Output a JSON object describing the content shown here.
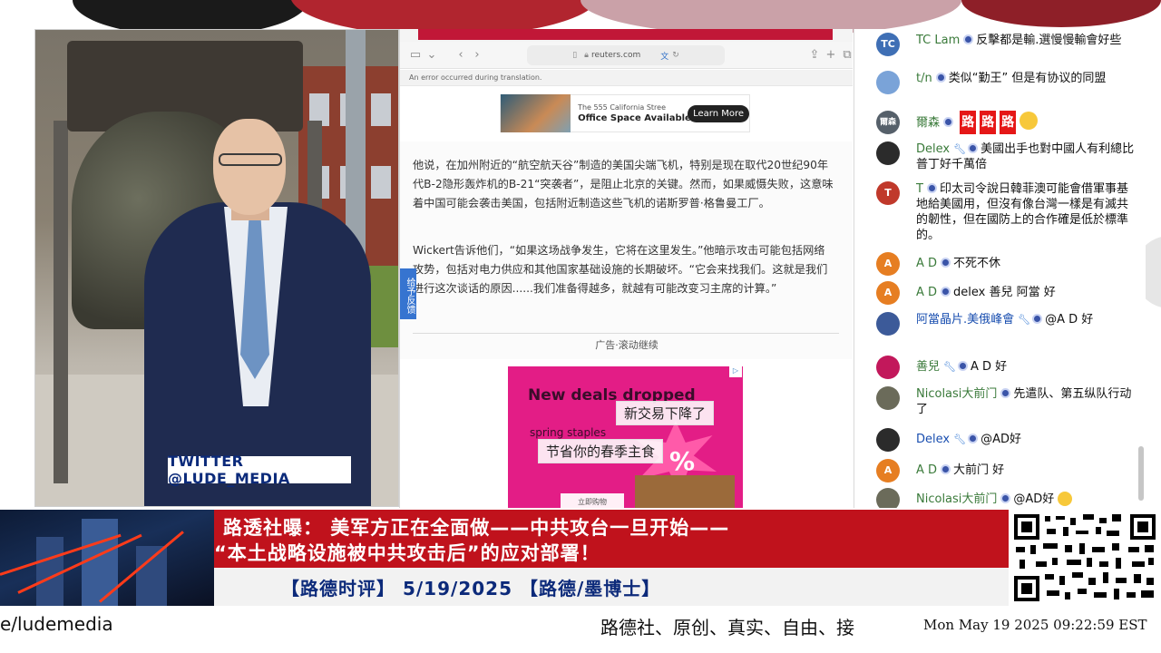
{
  "video": {
    "twitter_label": "TWITTER  @LUDE_MEDIA"
  },
  "browser": {
    "url": "reuters.com",
    "error_text": "An error occurred during translation.",
    "side_tab": "给予反馈",
    "ad_top": {
      "line1": "The 555 California Stree",
      "line2": "Office Space Available",
      "button": "Learn More"
    },
    "paragraphs": [
      "他说，在加州附近的“航空航天谷”制造的美国尖端飞机，特别是现在取代20世纪90年代B-2隐形轰炸机的B-21“突袭者”，是阻止北京的关键。然而，如果威慑失败，这意味着中国可能会袭击美国，包括附近制造这些飞机的诺斯罗普·格鲁曼工厂。",
      "Wickert告诉他们，“如果这场战争发生，它将在这里发生。”他暗示攻击可能包括网络攻势，包括对电力供应和其他国家基础设施的长期破坏。“它会来找我们。这就是我们进行这次谈话的原因......我们准备得越多，就越有可能改变习主席的计算。”"
    ],
    "ad_label": "广告·滚动继续",
    "ad_bottom": {
      "headline": "New deals dropped",
      "sub": "spring staples",
      "overlay1": "新交易下降了",
      "overlay2": "节省你的春季主食",
      "cta": "立即购物",
      "percent": "%"
    }
  },
  "chat": {
    "messages": [
      {
        "avatar": "TC",
        "avatar_color": "#3f6fb5",
        "name": "TC Lam",
        "text": "反擊都是輸.選慢慢輸會好些"
      },
      {
        "avatar": "",
        "avatar_color": "#7aa3d8",
        "name": "t/n",
        "text": "类似“勤王” 但是有协议的同盟"
      },
      {
        "avatar": "爾森",
        "avatar_color": "#56606a",
        "name": "爾森",
        "text": ""
      },
      {
        "avatar": "",
        "avatar_color": "#2b2b2b",
        "name": "Delex",
        "text": "美國出手也對中國人有利總比普丁好千萬倍"
      },
      {
        "avatar": "T",
        "avatar_color": "#c0392b",
        "name": "T",
        "text": "印太司令說日韓菲澳可能會借軍事基地給美國用，但沒有像台灣一樣是有滅共的韌性，但在國防上的合作確是低於標準的。"
      },
      {
        "avatar": "A",
        "avatar_color": "#e67e22",
        "name": "A D",
        "text": "不死不休"
      },
      {
        "avatar": "A",
        "avatar_color": "#e67e22",
        "name": "A D",
        "text": "delex 善兒 阿當 好"
      },
      {
        "avatar": "",
        "avatar_color": "#3c5a99",
        "name": "阿當晶片.美俄峰會",
        "text": "@A D 好"
      },
      {
        "avatar": "",
        "avatar_color": "#c2185b",
        "name": "善兒",
        "text": "A D 好"
      },
      {
        "avatar": "",
        "avatar_color": "#6b6b5a",
        "name": "Nicolasi大前门",
        "text": "先遣队、第五纵队行动了"
      },
      {
        "avatar": "",
        "avatar_color": "#2b2b2b",
        "name": "Delex",
        "text": "@AD好"
      },
      {
        "avatar": "A",
        "avatar_color": "#e67e22",
        "name": "A D",
        "text": "大前门 好"
      },
      {
        "avatar": "",
        "avatar_color": "#6b6b5a",
        "name": "Nicolasi大前门",
        "text": "@AD好"
      }
    ],
    "road_chars": [
      "路",
      "路",
      "路"
    ]
  },
  "lower_third": {
    "headline_line1": "路透社曝：  美军方正在全面做——中共攻台一旦开始——",
    "headline_line2": "“本土战略设施被中共攻击后”的应对部署！",
    "show": "【路德时评】 5/19/2025 【路德/墨博士】"
  },
  "ticker": {
    "handle": "e/ludemedia",
    "slogan": "路德社、原创、真实、自由、接",
    "clock": "Mon May 19 2025 09:22:59 EST"
  },
  "colors": {
    "red_band": "#c0121c",
    "navy_text": "#0c2a7a",
    "link_blue": "#1a4fb0",
    "chat_name_green": "#3a7a3a"
  }
}
